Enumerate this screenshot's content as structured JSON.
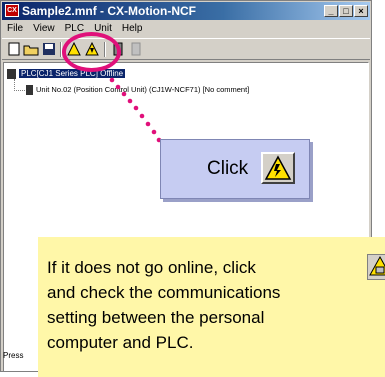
{
  "window": {
    "app_icon_text": "CX",
    "title": "Sample2.mnf - CX-Motion-NCF",
    "controls": [
      "_",
      "□",
      "×"
    ]
  },
  "menu": [
    "File",
    "View",
    "PLC",
    "Unit",
    "Help"
  ],
  "toolbar": {
    "icons": [
      "new-file-icon",
      "open-folder-icon",
      "save-icon",
      "online-warning-icon",
      "transfer-icon",
      "unit-icon",
      "unit-disabled-icon"
    ]
  },
  "tree": {
    "plc_label": "PLC[CJ1 Series PLC] Offline",
    "unit_label": "Unit No.02 (Position Control Unit) (CJ1W-NCF71) [No comment]"
  },
  "status": "Press",
  "callout": {
    "text": "Click"
  },
  "note": {
    "line1": "If it does not go online, click",
    "line2": "and check the communications",
    "line3": "setting between the personal",
    "line4": "computer and PLC."
  },
  "colors": {
    "highlight": "#e0107a",
    "callout_bg": "#c6ccf2",
    "note_bg": "#fff7a8",
    "title_bg": "#0a246a"
  }
}
